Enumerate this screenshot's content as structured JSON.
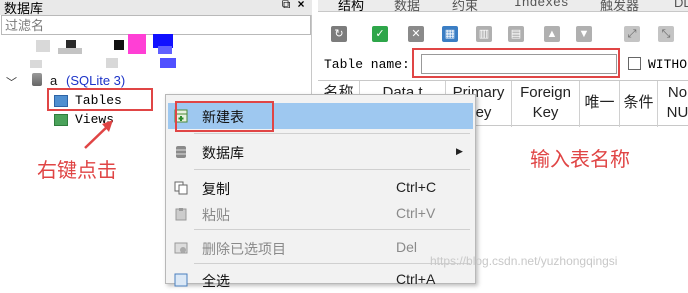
{
  "left_panel": {
    "title": "数据库",
    "float_icon": "restore-icon",
    "close_icon": "close-icon",
    "filter_placeholder": "过滤名",
    "db_prefix": "a",
    "db_label": "(SQLite 3)",
    "tree": [
      "Tables",
      "Views"
    ]
  },
  "right_panel": {
    "tabs": [
      "结构",
      "数据",
      "约束",
      "Indexes",
      "触发器",
      "DL"
    ],
    "table_name_label": "Table name:",
    "without_label": "WITHO",
    "columns": [
      "名称",
      "Data t",
      "Primary Key",
      "Foreign Key",
      "唯一",
      "条件",
      "No NU"
    ]
  },
  "context_menu": {
    "items": [
      {
        "label": "新建表",
        "shortcut": "",
        "icon": "new-table-icon"
      },
      {
        "label": "数据库",
        "shortcut": "",
        "icon": "database-icon"
      },
      {
        "label": "复制",
        "shortcut": "Ctrl+C",
        "icon": "copy-icon"
      },
      {
        "label": "粘贴",
        "shortcut": "Ctrl+V",
        "icon": "paste-icon"
      },
      {
        "label": "删除已选项目",
        "shortcut": "Del",
        "icon": "delete-icon"
      },
      {
        "label": "全选",
        "shortcut": "Ctrl+A",
        "icon": "select-all-icon"
      }
    ]
  },
  "annotations": {
    "right_click": "右键点击",
    "enter_table_name": "输入表名称"
  },
  "watermark": "https://blog.csdn.net/yuzhongqingsi",
  "colors": {
    "annotation_red": "#e04545",
    "menu_highlight": "#9ec8f0",
    "db_label_blue": "#1c33c8"
  }
}
